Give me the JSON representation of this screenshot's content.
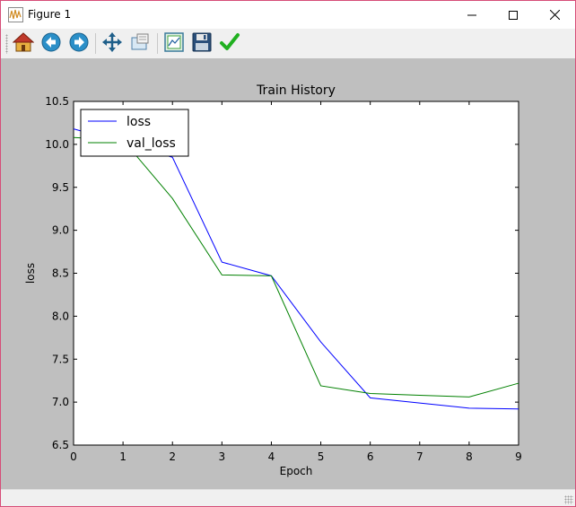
{
  "window": {
    "title": "Figure 1",
    "accent_border": "#d64d78"
  },
  "toolbar": {
    "buttons": [
      {
        "name": "home",
        "icon": "home-icon"
      },
      {
        "name": "back",
        "icon": "back-arrow-icon"
      },
      {
        "name": "forward",
        "icon": "forward-arrow-icon"
      },
      {
        "name": "pan",
        "icon": "move-icon"
      },
      {
        "name": "zoom",
        "icon": "zoom-rect-icon"
      },
      {
        "name": "subplots",
        "icon": "subplots-icon"
      },
      {
        "name": "save",
        "icon": "floppy-disk-icon"
      },
      {
        "name": "edit",
        "icon": "checkmark-icon"
      }
    ]
  },
  "statusbar": {
    "text": ""
  },
  "chart_data": {
    "type": "line",
    "title": "Train History",
    "xlabel": "Epoch",
    "ylabel": "loss",
    "xlim": [
      0,
      9
    ],
    "ylim": [
      6.5,
      10.5
    ],
    "x_ticks": [
      "0",
      "1",
      "2",
      "3",
      "4",
      "5",
      "6",
      "7",
      "8",
      "9"
    ],
    "y_ticks": [
      "6.5",
      "7.0",
      "7.5",
      "8.0",
      "8.5",
      "9.0",
      "9.5",
      "10.0",
      "10.5"
    ],
    "x": [
      0,
      1,
      2,
      3,
      4,
      5,
      6,
      7,
      8,
      9
    ],
    "series": [
      {
        "name": "loss",
        "color": "#0000ff",
        "values": [
          10.18,
          10.02,
          9.85,
          8.63,
          8.47,
          7.7,
          7.05,
          6.99,
          6.93,
          6.92
        ]
      },
      {
        "name": "val_loss",
        "color": "#008000",
        "values": [
          10.08,
          10.05,
          9.37,
          8.48,
          8.47,
          7.19,
          7.1,
          7.08,
          7.06,
          7.22
        ]
      }
    ],
    "legend": "top-left",
    "grid": false,
    "background": "#ffffff",
    "figure_background": "#bfbfbf"
  }
}
